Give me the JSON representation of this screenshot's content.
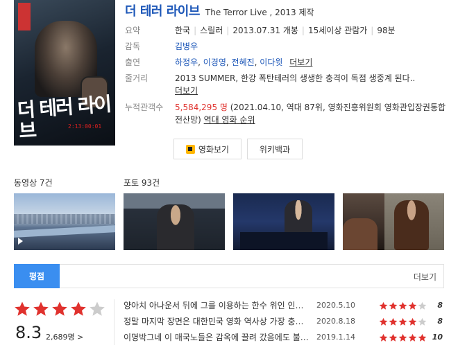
{
  "poster": {
    "title": "더 테러 라이브",
    "timer": "2:13:00:01"
  },
  "movie": {
    "title": "더 테러 라이브",
    "subtitle": "The Terror Live , 2013 제작"
  },
  "info": {
    "summary": {
      "label": "요약",
      "country": "한국",
      "genre": "스릴러",
      "release": "2013.07.31 개봉",
      "rating": "15세이상 관람가",
      "runtime": "98분"
    },
    "director": {
      "label": "감독",
      "name": "김병우"
    },
    "cast": {
      "label": "출연",
      "names": [
        "하정우",
        "이경영",
        "전혜진",
        "이다윗"
      ],
      "more": "더보기"
    },
    "plot": {
      "label": "줄거리",
      "text": "2013 SUMMER, 한강 폭탄테러의 생생한 충격이 독점 생중계 된다.. ",
      "more": "더보기"
    },
    "audience": {
      "label": "누적관객수",
      "count": "5,584,295 명",
      "detail": " (2021.04.10, 역대 87위, 영화진흥위원회 영화관입장권통합전산망) ",
      "rank_link": "역대 영화 순위"
    }
  },
  "buttons": {
    "watch": "영화보기",
    "wiki": "위키백과"
  },
  "media": {
    "video_label": "동영상 7건",
    "photo_label": "포토 93건"
  },
  "tabs": {
    "active": "평점",
    "more": "더보기"
  },
  "rating": {
    "stars": 4,
    "score": "8.3",
    "count": "2,689명 >"
  },
  "reviews": [
    {
      "text": "양아치 아나운서 뒤에 그를 이용하는 한수 위인 인간이 있더라는",
      "date": "2020.5.10",
      "stars": 4,
      "score": "8"
    },
    {
      "text": "정말 마지막 장면은 대한민국 영화 역사상 가장 충격적이었다",
      "date": "2020.8.18",
      "stars": 4,
      "score": "8"
    },
    {
      "text": "이명박그네 이 매국노들은 감옥에 끌려 갔음에도 불구하고",
      "date": "2019.1.14",
      "stars": 5,
      "score": "10"
    }
  ],
  "colors": {
    "link": "#1d57b8",
    "accent": "#3a8ef0",
    "star": "#e0322e",
    "star_empty": "#cccccc",
    "highlight": "#e0322e"
  }
}
